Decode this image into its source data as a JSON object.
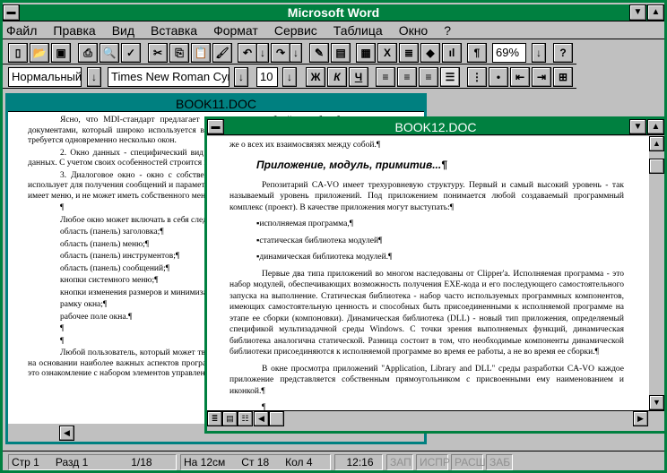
{
  "app": {
    "title": "Microsoft Word"
  },
  "menu": [
    "Файл",
    "Правка",
    "Вид",
    "Вставка",
    "Формат",
    "Сервис",
    "Таблица",
    "Окно",
    "?"
  ],
  "toolbar": {
    "zoom": "69%",
    "style": "Нормальный",
    "font": "Times New Roman Cyr",
    "size": "10",
    "bold": "Ж",
    "italic": "К",
    "underline": "Ч",
    "pilcrow": "¶"
  },
  "book11": {
    "title": "BOOK11.DOC",
    "paragraphs": [
      "Ясно, что MDI-стандарт предлагает пользователю удобный способ работы с несколькими документами, который широко используется в приложениях Windows и тех приложениях, в которых требуется одновременно несколько окон.",
      "2. Окно данных - специфический вид окна, используемый для работы пользователя с базами данных. С учетом своих особенностей строится по типу MDI-приложения.¶",
      "3. Диалоговое окно - окно с собственным набором элементов управления, которое система использует для получения сообщений и параметров. В отличие от других видов окон, диалоговое окно не имеет меню, и не может иметь собственного меню.¶",
      "¶",
      "Любое окно может включать в себя следующие элементы:",
      "область (панель) заголовка;¶",
      "область (панель) меню;¶",
      "область (панель) инструментов;¶",
      "область (панель) сообщений;¶",
      "кнопки системного меню;¶",
      "кнопки изменения размеров и минимизации окна;¶",
      "рамку окна;¶",
      "рабочее поле окна.¶",
      "¶",
      "¶",
      "Любой пользователь, который может творчески выбирать средства, присущие его инструментам, на основании наиболее важных аспектов программы. Простейший переход пользователя к среде CA-VO это ознакомление с набором элементов управления окна."
    ]
  },
  "book12": {
    "title": "BOOK12.DOC",
    "first_line": "же о всех их взаимосвязях между собой.¶",
    "heading": "Приложение, модуль, примитив...¶",
    "p1": "Репозитарий CA-VO имеет трехуровневую структуру. Первый и самый высокий уровень - так называемый уровень приложений. Под приложением понимается любой создаваемый программный комплекс (проект). В качестве приложения могут выступать:¶",
    "bullets": [
      "исполняемая программа,¶",
      "статическая библиотека модулей¶",
      "динамическая библиотека модулей.¶"
    ],
    "p2": "Первые два типа приложений во многом наследованы от Clipper'a. Исполняемая программа - это набор модулей, обеспечивающих возможность получения EXE-кода и его последующего самостоятельного запуска на выполнение. Статическая библиотека - набор часто используемых программных компонентов, имеющих самостоятельную ценность и способных быть присоединенными к исполняемой программе на этапе ее сборки (компоновки). Динамическая библиотека (DLL) - новый тип приложения, определяемый спецификой мультизадачной среды Windows. С точки зрения выполняемых функций, динамическая библиотека аналогична статической. Разница состоит в том, что необходимые компоненты динамической библиотеки присоединяются к исполняемой программе во время ее работы, а не во время ее сборки.¶",
    "p3": "В окне просмотра приложений \"Application, Library and DLL\" среды разработки CA-VO каждое приложение представляется собственным прямоугольником с присвоенными ему наименованием и иконкой.¶",
    "p4": "¶"
  },
  "status": {
    "page": "Стр 1",
    "section": "Разд 1",
    "pages": "1/18",
    "at": "На 12см",
    "line": "Ст 18",
    "col": "Кол 4",
    "time": "12:16",
    "rec": "ЗАП",
    "mrk": "ИСПР",
    "ext": "РАСШ",
    "ovr": "ЗАБ"
  }
}
